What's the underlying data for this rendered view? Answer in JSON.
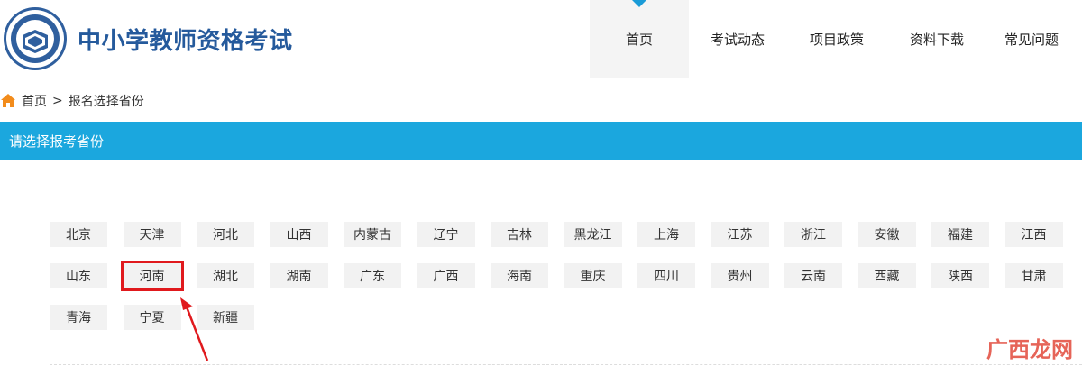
{
  "header": {
    "site_title": "中小学教师资格考试",
    "nav": [
      {
        "label": "首页",
        "active": true
      },
      {
        "label": "考试动态",
        "active": false
      },
      {
        "label": "项目政策",
        "active": false
      },
      {
        "label": "资料下载",
        "active": false
      },
      {
        "label": "常见问题",
        "active": false
      }
    ]
  },
  "breadcrumb": {
    "home": "首页",
    "separator": ">",
    "current": "报名选择省份"
  },
  "province_bar": {
    "title": "请选择报考省份"
  },
  "provinces": [
    "北京",
    "天津",
    "河北",
    "山西",
    "内蒙古",
    "辽宁",
    "吉林",
    "黑龙江",
    "上海",
    "江苏",
    "浙江",
    "安徽",
    "福建",
    "江西",
    "山东",
    "河南",
    "湖北",
    "湖南",
    "广东",
    "广西",
    "海南",
    "重庆",
    "四川",
    "贵州",
    "云南",
    "西藏",
    "陕西",
    "甘肃",
    "青海",
    "宁夏",
    "新疆"
  ],
  "highlighted_province": "河南",
  "watermark": "广西龙网",
  "colors": {
    "brand_blue": "#255a9c",
    "bar_blue": "#1ba7de",
    "highlight_red": "#e0191d",
    "home_icon": "#f28c1c"
  },
  "icons": {
    "logo": "book-seal-icon",
    "home": "home-icon",
    "annotation": "red-arrow-icon"
  }
}
